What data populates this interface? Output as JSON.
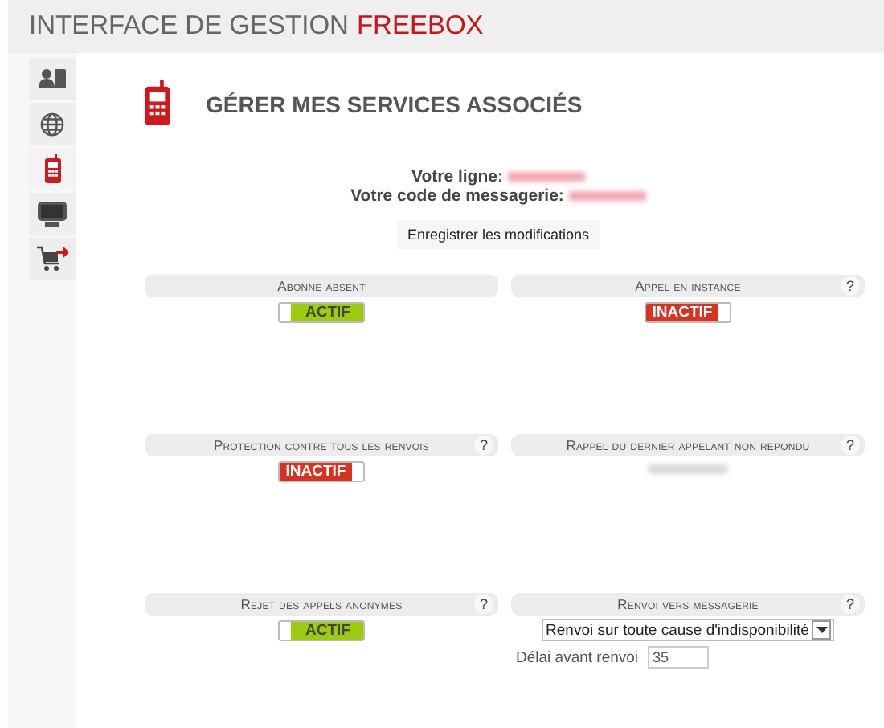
{
  "header": {
    "title": "INTERFACE DE GESTION",
    "brand": "FREEBOX"
  },
  "sidebar": {
    "items": [
      {
        "selected": false
      },
      {
        "selected": false
      },
      {
        "selected": true
      },
      {
        "selected": false
      },
      {
        "selected": false
      }
    ]
  },
  "page": {
    "title": "GÉRER MES SERVICES ASSOCIÉS",
    "line_label": "Votre ligne:",
    "voicemail_label": "Votre code de messagerie:",
    "save_button": "Enregistrer les modifications"
  },
  "services": [
    {
      "kind": "toggle",
      "title": "Abonne absent",
      "on": true,
      "state_label": "ACTIF"
    },
    {
      "kind": "toggle",
      "title": "Appel en instance",
      "help": "?",
      "on": false,
      "state_label": "INACTIF"
    },
    {
      "kind": "toggle",
      "title": "Protection contre tous les renvois",
      "help": "?",
      "on": false,
      "state_label": "INACTIF"
    },
    {
      "kind": "redacted",
      "title": "Rappel du dernier appelant non repondu",
      "help": "?"
    },
    {
      "kind": "toggle",
      "title": "Rejet des appels anonymes",
      "help": "?",
      "on": true,
      "state_label": "ACTIF"
    },
    {
      "kind": "forward",
      "title": "Renvoi vers messagerie",
      "help": "?",
      "select_value": "Renvoi sur toute cause d'indisponibilité",
      "delay_label": "Délai avant renvoi",
      "delay_value": "35"
    }
  ]
}
